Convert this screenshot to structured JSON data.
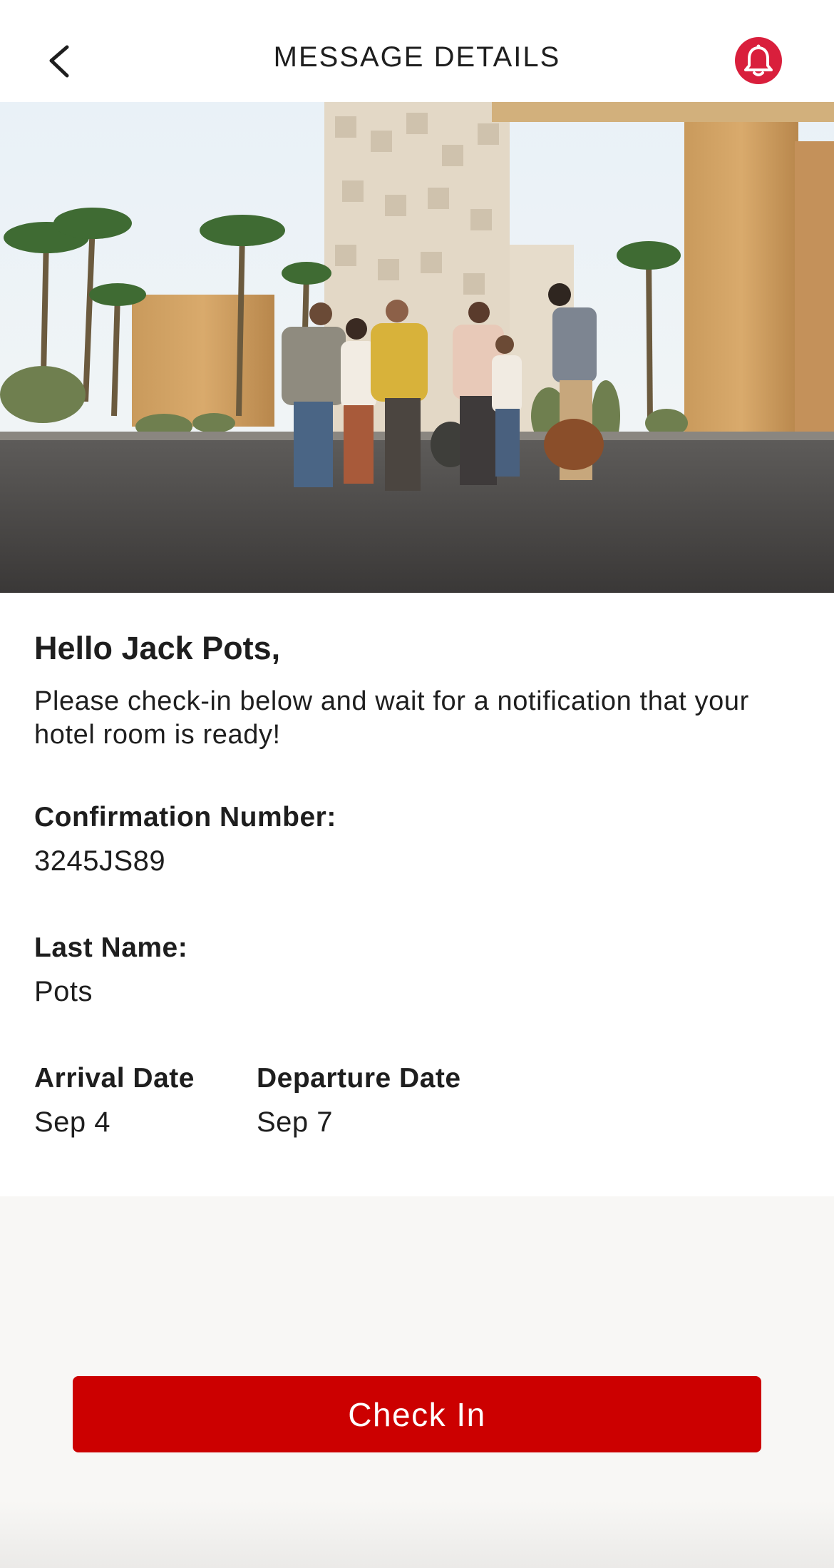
{
  "header": {
    "title": "MESSAGE DETAILS",
    "back_icon": "chevron-left-icon",
    "bell_icon": "bell-icon",
    "accent_color": "#d91f3c"
  },
  "hero": {
    "image": "group-of-guests-walking-at-hotel-entrance-photo"
  },
  "message": {
    "greeting": "Hello Jack Pots,",
    "body": "Please check-in below and wait for a notification that your hotel room is ready!"
  },
  "details": {
    "confirmation_label": "Confirmation Number:",
    "confirmation_value": "3245JS89",
    "last_name_label": "Last Name:",
    "last_name_value": "Pots",
    "arrival_label": "Arrival Date",
    "arrival_value": "Sep 4",
    "departure_label": "Departure Date",
    "departure_value": "Sep 7"
  },
  "footer": {
    "checkin_label": "Check In",
    "button_color": "#cc0000"
  }
}
